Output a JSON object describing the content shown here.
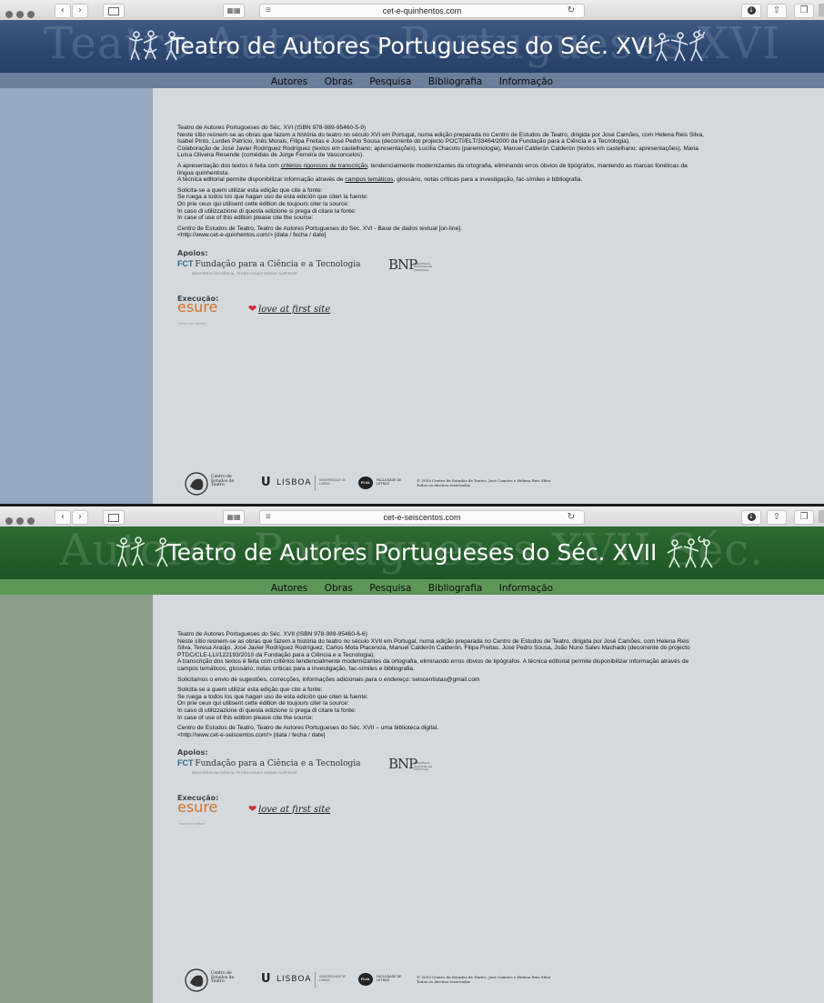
{
  "windows": [
    {
      "url": "cet-e-quinhentos.com",
      "site_title": "Teatro de Autores Portugueses do Séc. XVI",
      "banner_watermark": "Teatro Autores Portugueses XVI",
      "accent_color": "#2c4770",
      "menu": [
        "Autores",
        "Obras",
        "Pesquisa",
        "Bibliografia",
        "Informação"
      ],
      "intro_lines": [
        "Teatro de Autores Portugueses do Séc. XVI (ISBN 978-989-95460-5-9)",
        "Neste sítio reúnem-se as obras que fazem a história do teatro no século XVI em Portugal, numa edição preparada no Centro de Estudos de Teatro, dirigida por José Camões, com Helena Reis Silva,",
        "Isabel Pinto, Lurdes Patrício, Inês Morais, Filipa Freitas e José Pedro Sousa (decorrente do projecto POCTI/ELT/33464/2000 da Fundação para a Ciência e a Tecnologia).",
        "Colaboração de José Javier Rodríguez Rodríguez (textos em castelhano; apresentações), Lucília Chacoto (paremiologia), Manuel Calderón Calderón (textos em castelhano; apresentações), Maria",
        "Luísa Oliveira Resende (comédias de Jorge Ferreira de Vasconcelos)."
      ],
      "method": {
        "pre": "A apresentação dos textos é feita com ",
        "link1": "critérios rigorosos de transcrição",
        "mid": ", tendencialmente modernizantes da ortografia, eliminando erros óbvios de tipógrafos, mantendo as marcas fonéticas da",
        "line2": "língua quinhentista.",
        "line3_pre": "A técnica editorial permite disponibilizar informação através de ",
        "link2": "campos temáticos",
        "line3_post": ", glossário, notas críticas para a investigação, fac-símiles e bibliografia."
      },
      "cite_lines": [
        "Solicita-se a quem utilizar esta edição que cite a fonte:",
        "Se ruega a todos los que hagan uso de esta edición que citen la fuente:",
        "On prie ceux qui utilisent cette édition de toujours citer la source:",
        "In caso di utilizzazione di questa edizione si prega di citare la fonte:",
        "In case of use of this edition please cite the source:"
      ],
      "reference_lines": [
        "Centro de Estudos de Teatro, Teatro de Autores Portugueses do Séc. XVI - Base de dados textual [on-line].",
        "<http://www.cet-e-quinhentos.com/> [data / fecha / date]"
      ]
    },
    {
      "url": "cet-e-seiscentos.com",
      "site_title": "Teatro de Autores Portugueses do Séc. XVII",
      "banner_watermark": "Autores Portugueses XVII Séc.",
      "accent_color": "#235d2a",
      "menu": [
        "Autores",
        "Obras",
        "Pesquisa",
        "Bibliografia",
        "Informação"
      ],
      "intro_lines": [
        "Teatro de Autores Portugueses do Séc. XVII (ISBN 978-989-95460-6-6)",
        "Neste sítio reúnem-se as obras que fazem a história do teatro no século XVII em Portugal, numa edição preparada no Centro de Estudos de Teatro, dirigida por José Camões, com Helena Reis",
        "Silva, Teresa Araújo, José Javier Rodríguez Rodríguez, Carlos Mota Placencia, Manuel Calderón Calderón, Filipa Freitas, José Pedro Sousa, João Nuno Sales Machado (decorrente do projecto",
        "PTDC/CLE-LLI/122193/2010 da Fundação para a Ciência e a Tecnologia).",
        "A transcrição dos textos é feita com critérios tendencialmente modernizantes da ortografia, eliminando erros óbvios de tipógrafos. A técnica editorial permite disponibilizar informação através de",
        "campos temáticos, glossário, notas críticas para a investigação, fac-símiles e bibliografia."
      ],
      "suggestions": "Solicitamos o envio de sugestões, correcções, informações adicionais para o endereço: seiscentistas@gmail.com",
      "cite_lines": [
        "Solicita-se a quem utilizar esta edição que cite a fonte:",
        "Se ruega a todos los que hagan uso de esta edición que citen la fuente:",
        "On prie ceux qui utilisent cette édition de toujours citer la source:",
        "In caso di utilizzazione di questa edizione si prega di citare la fonte:",
        "In case of use of this edition please cite the source:"
      ],
      "reference_lines": [
        "Centro de Estudos de Teatro, Teatro de Autores Portugueses do Séc. XVII – uma biblioteca digital.",
        "<http://www.cet-e-seiscentos.com/> [data / fecha / date]"
      ]
    }
  ],
  "shared": {
    "apoios_label": "Apoios:",
    "execucao_label": "Execução:",
    "fct_mark": "FCT",
    "fct_name": "Fundação para a Ciência e a Tecnologia",
    "fct_sub": "MINISTÉRIO DA CIÊNCIA, TECNOLOGIA E ENSINO SUPERIOR",
    "bnp_mark": "BNP",
    "bnp_sub": "BIBLIOTECA NACIONAL DE PORTUGAL",
    "esure_mark": "esure",
    "esure_sub": "know your options",
    "lafs_text": "love at first site",
    "cet_name": "Centro de Estudos de Teatro",
    "ulisboa": "LISBOA",
    "ulisboa_sub": "UNIVERSIDADE DE LISBOA",
    "flul_badge": "FLUL",
    "flul_text": "FACULDADE DE LETRAS",
    "copyright_1": "© 2010 Centro de Estudos de Teatro, José Camões e Helena Reis Silva",
    "copyright_2": "Todos os direitos reservados"
  },
  "icons": [
    "chevron-left-icon",
    "chevron-right-icon",
    "sidebar-icon",
    "grid-icon",
    "reader-icon",
    "reload-icon",
    "download-icon",
    "share-icon",
    "tabs-icon",
    "heart-icon"
  ]
}
